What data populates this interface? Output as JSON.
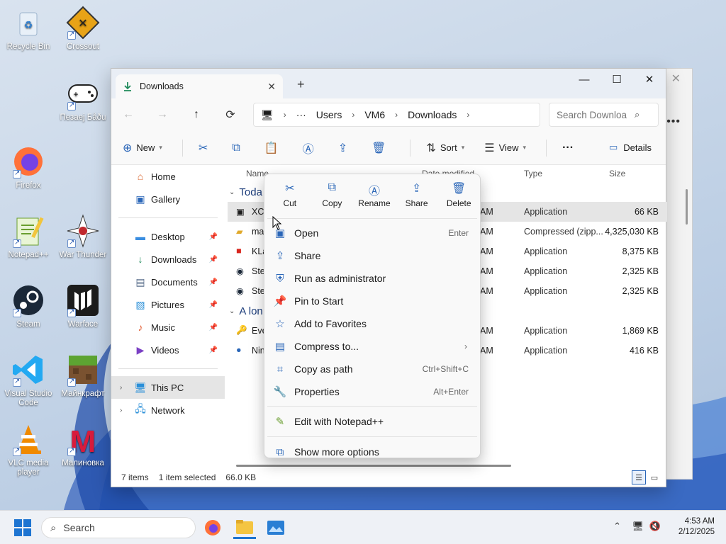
{
  "desktop": {
    "icons": [
      {
        "label": "Recycle Bin"
      },
      {
        "label": "Crossout"
      },
      {
        "label": "Пезаеј Бåðu"
      },
      {
        "label": "Firefox"
      },
      {
        "label": "Notepad++"
      },
      {
        "label": "War Thunder"
      },
      {
        "label": "Steam"
      },
      {
        "label": "Warface"
      },
      {
        "label": "Visual Studio Code"
      },
      {
        "label": "Майнкрафт"
      },
      {
        "label": "VLC media player"
      },
      {
        "label": "Малиновка"
      }
    ]
  },
  "window": {
    "tab_title": "Downloads",
    "new_tab": "+",
    "breadcrumb": [
      "Users",
      "VM6",
      "Downloads"
    ],
    "search_placeholder": "Search Downloa",
    "toolbar": {
      "new": "New",
      "sort": "Sort",
      "view": "View",
      "more": "···",
      "details": "Details"
    }
  },
  "sidebar": {
    "items": [
      {
        "label": "Home"
      },
      {
        "label": "Gallery"
      },
      {
        "label": "Desktop"
      },
      {
        "label": "Downloads"
      },
      {
        "label": "Documents"
      },
      {
        "label": "Pictures"
      },
      {
        "label": "Music"
      },
      {
        "label": "Videos"
      },
      {
        "label": "This PC"
      },
      {
        "label": "Network"
      }
    ]
  },
  "filelist": {
    "headers": {
      "name": "Name",
      "date": "Date modified",
      "type": "Type",
      "size": "Size"
    },
    "groups": [
      "Today",
      "A long time ago"
    ],
    "group_visible": [
      "Toda",
      "A lon"
    ],
    "rows": [
      {
        "name": "XCl",
        "date": "AM",
        "type": "Application",
        "size": "66 KB"
      },
      {
        "name": "ma",
        "date": "AM",
        "type": "Compressed (zipp...",
        "size": "4,325,030 KB"
      },
      {
        "name": "KLa",
        "date": "AM",
        "type": "Application",
        "size": "8,375 KB"
      },
      {
        "name": "Ste",
        "date": "AM",
        "type": "Application",
        "size": "2,325 KB"
      },
      {
        "name": "Ste",
        "date": "AM",
        "type": "Application",
        "size": "2,325 KB"
      },
      {
        "name": "Eve",
        "date": "AM",
        "type": "Application",
        "size": "1,869 KB"
      },
      {
        "name": "Nin",
        "date": "AM",
        "type": "Application",
        "size": "416 KB"
      }
    ]
  },
  "status": {
    "items": "7 items",
    "selected": "1 item selected",
    "size": "66.0 KB"
  },
  "context_menu": {
    "quick": [
      {
        "label": "Cut"
      },
      {
        "label": "Copy"
      },
      {
        "label": "Rename"
      },
      {
        "label": "Share"
      },
      {
        "label": "Delete"
      }
    ],
    "items": [
      {
        "label": "Open",
        "shortcut": "Enter"
      },
      {
        "label": "Share",
        "shortcut": ""
      },
      {
        "label": "Run as administrator",
        "shortcut": ""
      },
      {
        "label": "Pin to Start",
        "shortcut": ""
      },
      {
        "label": "Add to Favorites",
        "shortcut": ""
      },
      {
        "label": "Compress to...",
        "shortcut": ""
      },
      {
        "label": "Copy as path",
        "shortcut": "Ctrl+Shift+C"
      },
      {
        "label": "Properties",
        "shortcut": "Alt+Enter"
      }
    ],
    "notepad": "Edit with Notepad++",
    "more": "Show more options"
  },
  "taskbar": {
    "search": "Search",
    "time": "4:53 AM",
    "date": "2/12/2025"
  }
}
